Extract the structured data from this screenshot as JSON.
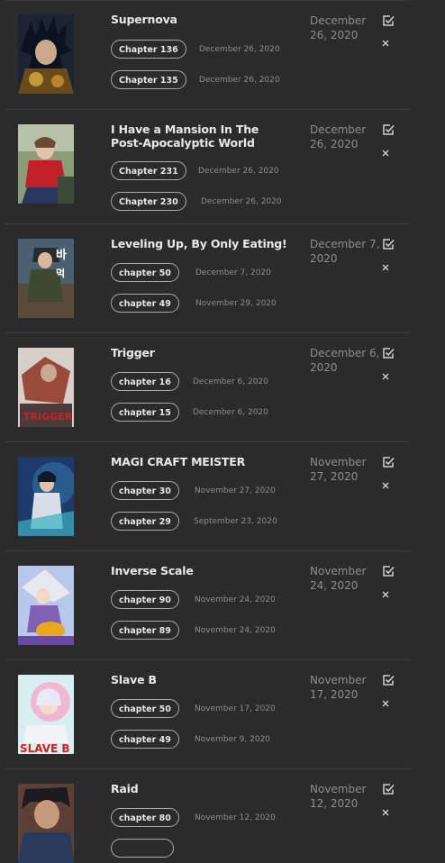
{
  "rows": [
    {
      "title": "Supernova",
      "chapters": [
        {
          "label": "Chapter 136",
          "date": "December 26, 2020"
        },
        {
          "label": "Chapter 135",
          "date": "December 26, 2020"
        }
      ],
      "updated": "December 26, 2020"
    },
    {
      "title": "I Have a Mansion In The Post-Apocalyptic World",
      "chapters": [
        {
          "label": "Chapter 231",
          "date": "December 26, 2020"
        },
        {
          "label": "Chapter 230",
          "date": "December 26, 2020"
        }
      ],
      "updated": "December 26, 2020"
    },
    {
      "title": "Leveling Up, By Only Eating!",
      "chapters": [
        {
          "label": "chapter 50",
          "date": "December 7, 2020"
        },
        {
          "label": "chapter 49",
          "date": "November 29, 2020"
        }
      ],
      "updated": "December 7, 2020"
    },
    {
      "title": "Trigger",
      "chapters": [
        {
          "label": "chapter 16",
          "date": "December 6, 2020"
        },
        {
          "label": "chapter 15",
          "date": "December 6, 2020"
        }
      ],
      "updated": "December 6, 2020"
    },
    {
      "title": "MAGI CRAFT MEISTER",
      "chapters": [
        {
          "label": "chapter 30",
          "date": "November 27, 2020"
        },
        {
          "label": "chapter 29",
          "date": "September 23, 2020"
        }
      ],
      "updated": "November 27, 2020"
    },
    {
      "title": "Inverse Scale",
      "chapters": [
        {
          "label": "chapter 90",
          "date": "November 24, 2020"
        },
        {
          "label": "chapter 89",
          "date": "November 24, 2020"
        }
      ],
      "updated": "November 24, 2020"
    },
    {
      "title": "Slave B",
      "chapters": [
        {
          "label": "chapter 50",
          "date": "November 17, 2020"
        },
        {
          "label": "chapter 49",
          "date": "November 9, 2020"
        }
      ],
      "updated": "November 17, 2020"
    },
    {
      "title": "Raid",
      "chapters": [
        {
          "label": "chapter 80",
          "date": "November 12, 2020"
        },
        {
          "label": "",
          "date": ""
        }
      ],
      "updated": "November 12, 2020"
    }
  ],
  "icons": {
    "mark_read": "check-square-icon",
    "remove": "close-icon"
  },
  "colors": {
    "background": "#2b2b2b",
    "title": "#e8e8e8",
    "muted": "#8e8e8e",
    "border": "#a8a8a8"
  }
}
